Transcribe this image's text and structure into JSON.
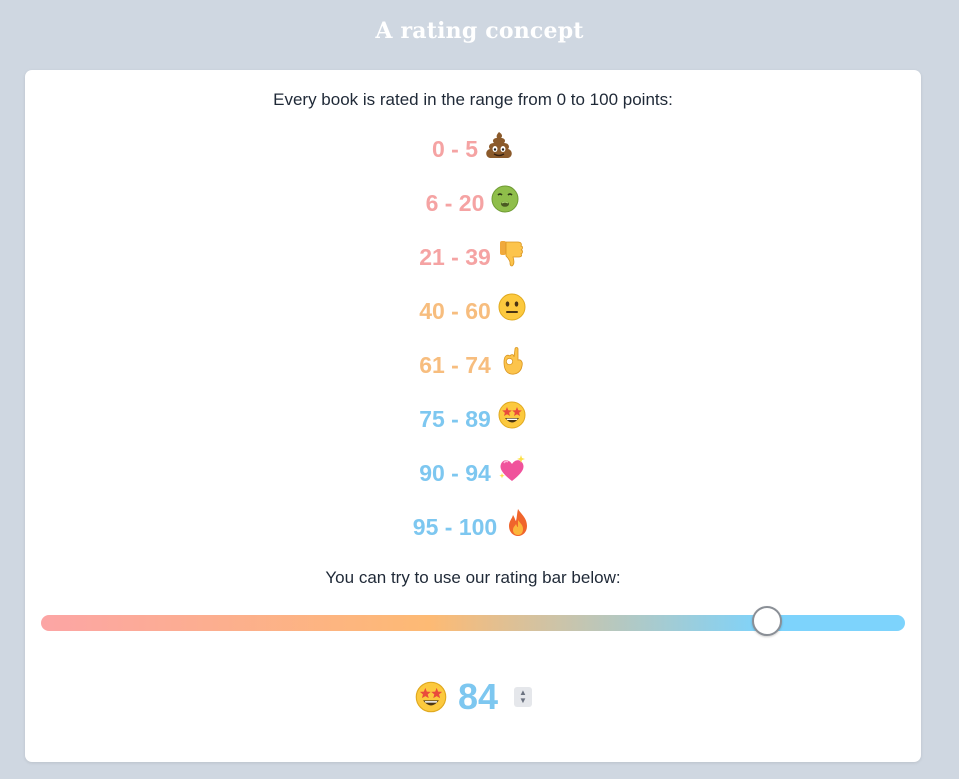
{
  "page": {
    "title": "A rating concept"
  },
  "card": {
    "intro_text": "Every book is rated in the range from 0 to 100 points:",
    "ranges": [
      {
        "label": "0 - 5",
        "emoji": "pile-of-poo-icon",
        "color": "#f5a3a3"
      },
      {
        "label": "6 - 20",
        "emoji": "nauseated-face-icon",
        "color": "#f5a3a3"
      },
      {
        "label": "21 - 39",
        "emoji": "thumbs-down-icon",
        "color": "#f5a3a3"
      },
      {
        "label": "40 - 60",
        "emoji": "neutral-face-icon",
        "color": "#f7bd7e"
      },
      {
        "label": "61 - 74",
        "emoji": "ok-hand-icon",
        "color": "#f7bd7e"
      },
      {
        "label": "75 - 89",
        "emoji": "star-struck-icon",
        "color": "#7dc7f0"
      },
      {
        "label": "90 - 94",
        "emoji": "sparkling-heart-icon",
        "color": "#7dc7f0"
      },
      {
        "label": "95 - 100",
        "emoji": "fire-icon",
        "color": "#7dc7f0"
      }
    ],
    "try_text": "You can try to use our rating bar below:",
    "slider": {
      "min": 0,
      "max": 100,
      "value": 84
    },
    "rating": {
      "value": "84",
      "emoji": "star-struck-icon",
      "color": "#7dc7f0"
    },
    "colors": {
      "low": "#fca5a5",
      "mid": "#fdba74",
      "high": "#7dd3fc"
    }
  }
}
